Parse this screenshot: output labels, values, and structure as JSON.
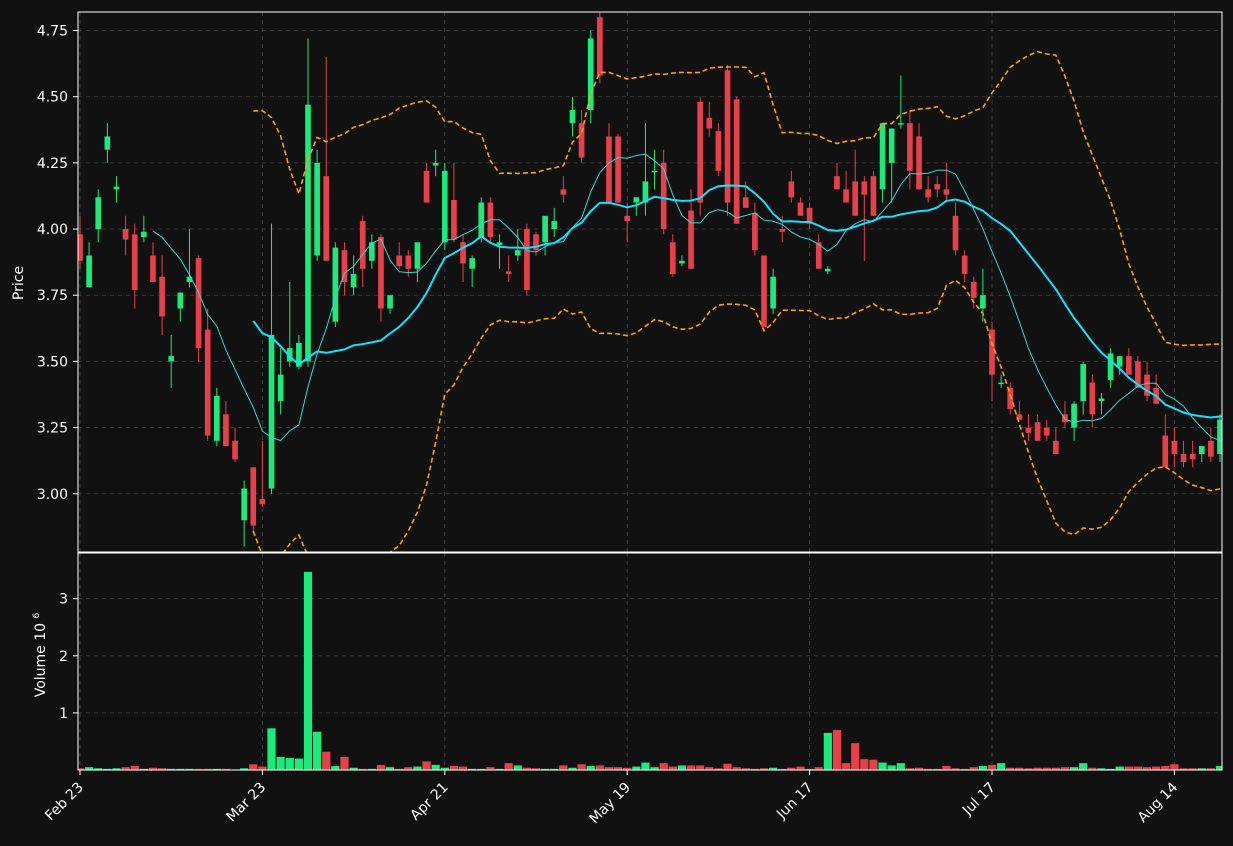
{
  "chart_data": {
    "type": "candlestick",
    "price_panel": {
      "ylabel": "Price",
      "yticks": [
        3.0,
        3.25,
        3.5,
        3.75,
        4.0,
        4.25,
        4.5,
        4.75
      ],
      "ytick_labels": [
        "3.00",
        "3.25",
        "3.50",
        "3.75",
        "4.00",
        "4.25",
        "4.50",
        "4.75"
      ],
      "ylim": [
        2.78,
        4.82
      ],
      "grid": true
    },
    "volume_panel": {
      "ylabel": "Volume",
      "ylabel_exponent": "10",
      "ylabel_exponent_power": "6",
      "yticks": [
        1,
        2,
        3
      ],
      "ytick_labels": [
        "1",
        "2",
        "3"
      ],
      "ylim": [
        0,
        3.8
      ],
      "unit": "millions",
      "grid": true
    },
    "x_tick_labels": [
      "Feb 23",
      "Mar 23",
      "Apr 21",
      "May 19",
      "Jun 17",
      "Jul 17",
      "Aug 14"
    ],
    "x_tick_index": [
      0,
      20,
      40,
      60,
      80,
      100,
      120
    ],
    "candles": [
      [
        3.98,
        4.05,
        3.85,
        3.88,
        0.03
      ],
      [
        3.78,
        3.95,
        3.78,
        3.9,
        0.05
      ],
      [
        4.0,
        4.15,
        3.95,
        4.12,
        0.03
      ],
      [
        4.3,
        4.4,
        4.25,
        4.35,
        0.02
      ],
      [
        4.15,
        4.2,
        4.1,
        4.16,
        0.03
      ],
      [
        4.0,
        4.05,
        3.9,
        3.96,
        0.05
      ],
      [
        3.98,
        4.02,
        3.7,
        3.77,
        0.07
      ],
      [
        3.97,
        4.05,
        3.95,
        3.99,
        0.02
      ],
      [
        3.9,
        3.95,
        3.8,
        3.8,
        0.04
      ],
      [
        3.82,
        3.9,
        3.6,
        3.67,
        0.03
      ],
      [
        3.5,
        3.6,
        3.4,
        3.52,
        0.02
      ],
      [
        3.7,
        3.75,
        3.65,
        3.76,
        0.02
      ],
      [
        3.8,
        4.0,
        3.78,
        3.82,
        0.02
      ],
      [
        3.89,
        3.9,
        3.5,
        3.55,
        0.02
      ],
      [
        3.62,
        3.7,
        3.2,
        3.22,
        0.02
      ],
      [
        3.2,
        3.4,
        3.18,
        3.37,
        0.02
      ],
      [
        3.3,
        3.35,
        3.18,
        3.18,
        0.02
      ],
      [
        3.2,
        3.25,
        3.12,
        3.13,
        0.01
      ],
      [
        2.9,
        3.05,
        2.8,
        3.02,
        0.03
      ],
      [
        3.1,
        3.1,
        2.85,
        2.88,
        0.1
      ],
      [
        2.98,
        3.2,
        2.95,
        2.96,
        0.06
      ],
      [
        3.02,
        4.02,
        3.0,
        3.6,
        0.73
      ],
      [
        3.35,
        3.55,
        3.3,
        3.45,
        0.23
      ],
      [
        3.5,
        3.8,
        3.48,
        3.55,
        0.21
      ],
      [
        3.48,
        3.6,
        3.47,
        3.57,
        0.2
      ],
      [
        3.5,
        4.72,
        3.48,
        4.47,
        3.47
      ],
      [
        3.9,
        4.3,
        3.88,
        4.25,
        0.67
      ],
      [
        4.2,
        4.65,
        3.88,
        3.88,
        0.32
      ],
      [
        3.65,
        3.95,
        3.63,
        3.93,
        0.07
      ],
      [
        3.92,
        3.95,
        3.75,
        3.8,
        0.23
      ],
      [
        3.78,
        3.9,
        3.75,
        3.83,
        0.04
      ],
      [
        4.03,
        4.05,
        3.78,
        3.85,
        0.02
      ],
      [
        3.88,
        3.98,
        3.85,
        3.95,
        0.02
      ],
      [
        3.97,
        3.98,
        3.65,
        3.7,
        0.09
      ],
      [
        3.7,
        3.75,
        3.68,
        3.75,
        0.05
      ],
      [
        3.9,
        3.95,
        3.85,
        3.86,
        0.02
      ],
      [
        3.9,
        3.92,
        3.82,
        3.85,
        0.05
      ],
      [
        3.85,
        3.9,
        3.8,
        3.95,
        0.06
      ],
      [
        4.22,
        4.25,
        4.1,
        4.1,
        0.15
      ],
      [
        4.24,
        4.3,
        4.2,
        4.25,
        0.09
      ],
      [
        3.95,
        4.25,
        3.92,
        4.22,
        0.04
      ],
      [
        4.11,
        4.25,
        3.95,
        3.96,
        0.07
      ],
      [
        3.95,
        3.98,
        3.8,
        3.87,
        0.06
      ],
      [
        3.85,
        3.9,
        3.78,
        3.89,
        0.02
      ],
      [
        3.97,
        4.12,
        3.95,
        4.1,
        0.02
      ],
      [
        4.1,
        4.12,
        3.95,
        3.97,
        0.05
      ],
      [
        3.94,
        3.98,
        3.85,
        3.95,
        0.02
      ],
      [
        3.84,
        3.9,
        3.8,
        3.83,
        0.12
      ],
      [
        3.9,
        4.0,
        3.88,
        3.92,
        0.08
      ],
      [
        4.0,
        4.02,
        3.75,
        3.77,
        0.04
      ],
      [
        3.98,
        3.99,
        3.9,
        3.92,
        0.03
      ],
      [
        3.95,
        4.05,
        3.9,
        4.05,
        0.02
      ],
      [
        4.0,
        4.08,
        3.97,
        4.03,
        0.02
      ],
      [
        4.15,
        4.2,
        4.1,
        4.13,
        0.08
      ],
      [
        4.4,
        4.5,
        4.35,
        4.45,
        0.04
      ],
      [
        4.4,
        4.45,
        4.25,
        4.27,
        0.1
      ],
      [
        4.45,
        4.75,
        4.4,
        4.72,
        0.07
      ],
      [
        4.8,
        4.82,
        4.55,
        4.58,
        0.08
      ],
      [
        4.35,
        4.4,
        4.15,
        4.1,
        0.05
      ],
      [
        4.35,
        4.36,
        4.15,
        4.1,
        0.05
      ],
      [
        4.05,
        4.1,
        3.95,
        4.03,
        0.04
      ],
      [
        4.1,
        4.12,
        4.05,
        4.12,
        0.06
      ],
      [
        4.1,
        4.4,
        4.05,
        4.18,
        0.13
      ],
      [
        4.22,
        4.3,
        4.15,
        4.22,
        0.05
      ],
      [
        4.25,
        4.3,
        3.98,
        4.0,
        0.12
      ],
      [
        3.95,
        3.98,
        3.82,
        3.83,
        0.06
      ],
      [
        3.87,
        3.9,
        3.86,
        3.88,
        0.08
      ],
      [
        4.07,
        4.15,
        3.85,
        3.85,
        0.08
      ],
      [
        4.48,
        4.5,
        4.05,
        4.1,
        0.08
      ],
      [
        4.42,
        4.48,
        4.35,
        4.38,
        0.05
      ],
      [
        4.37,
        4.4,
        4.2,
        4.22,
        0.03
      ],
      [
        4.6,
        4.62,
        4.05,
        4.1,
        0.11
      ],
      [
        4.49,
        4.5,
        4.02,
        4.02,
        0.05
      ],
      [
        4.12,
        4.18,
        4.08,
        4.08,
        0.03
      ],
      [
        4.06,
        4.1,
        3.9,
        3.92,
        0.02
      ],
      [
        3.9,
        3.9,
        3.65,
        3.63,
        0.03
      ],
      [
        3.7,
        3.85,
        3.68,
        3.82,
        0.04
      ],
      [
        4.0,
        4.05,
        3.95,
        3.99,
        0.02
      ],
      [
        4.18,
        4.22,
        4.1,
        4.12,
        0.04
      ],
      [
        4.1,
        4.12,
        4.08,
        4.05,
        0.06
      ],
      [
        4.08,
        4.1,
        4.0,
        4.02,
        0.02
      ],
      [
        3.95,
        3.98,
        3.85,
        3.85,
        0.05
      ],
      [
        3.84,
        3.86,
        3.83,
        3.85,
        0.65
      ],
      [
        4.2,
        4.25,
        4.15,
        4.15,
        0.7
      ],
      [
        4.15,
        4.22,
        4.1,
        4.1,
        0.12
      ],
      [
        4.18,
        4.3,
        4.05,
        4.05,
        0.47
      ],
      [
        4.18,
        4.2,
        3.88,
        4.13,
        0.19
      ],
      [
        4.2,
        4.22,
        4.05,
        4.05,
        0.18
      ],
      [
        4.15,
        4.4,
        4.1,
        4.4,
        0.13
      ],
      [
        4.25,
        4.35,
        4.1,
        4.38,
        0.08
      ],
      [
        4.4,
        4.58,
        4.38,
        4.4,
        0.12
      ],
      [
        4.4,
        4.45,
        4.15,
        4.22,
        0.03
      ],
      [
        4.35,
        4.4,
        4.15,
        4.15,
        0.04
      ],
      [
        4.15,
        4.2,
        4.1,
        4.12,
        0.02
      ],
      [
        4.17,
        4.2,
        4.12,
        4.15,
        0.02
      ],
      [
        4.15,
        4.25,
        4.1,
        4.13,
        0.07
      ],
      [
        4.05,
        4.1,
        3.9,
        3.92,
        0.03
      ],
      [
        3.9,
        3.92,
        3.8,
        3.83,
        0.02
      ],
      [
        3.8,
        3.82,
        3.7,
        3.74,
        0.05
      ],
      [
        3.7,
        3.85,
        3.65,
        3.75,
        0.07
      ],
      [
        3.62,
        3.65,
        3.35,
        3.45,
        0.09
      ],
      [
        3.42,
        3.45,
        3.4,
        3.42,
        0.12
      ],
      [
        3.4,
        3.42,
        3.3,
        3.32,
        0.04
      ],
      [
        3.3,
        3.35,
        3.28,
        3.28,
        0.04
      ],
      [
        3.25,
        3.3,
        3.2,
        3.23,
        0.03
      ],
      [
        3.27,
        3.3,
        3.2,
        3.2,
        0.04
      ],
      [
        3.25,
        3.28,
        3.2,
        3.22,
        0.04
      ],
      [
        3.2,
        3.25,
        3.15,
        3.15,
        0.04
      ],
      [
        3.3,
        3.35,
        3.25,
        3.27,
        0.05
      ],
      [
        3.25,
        3.35,
        3.2,
        3.34,
        0.05
      ],
      [
        3.35,
        3.5,
        3.3,
        3.49,
        0.12
      ],
      [
        3.42,
        3.45,
        3.25,
        3.3,
        0.04
      ],
      [
        3.35,
        3.38,
        3.3,
        3.36,
        0.03
      ],
      [
        3.43,
        3.55,
        3.4,
        3.53,
        0.02
      ],
      [
        3.48,
        3.5,
        3.45,
        3.52,
        0.06
      ],
      [
        3.52,
        3.55,
        3.45,
        3.45,
        0.06
      ],
      [
        3.5,
        3.52,
        3.4,
        3.4,
        0.06
      ],
      [
        3.45,
        3.5,
        3.35,
        3.37,
        0.05
      ],
      [
        3.4,
        3.45,
        3.35,
        3.34,
        0.06
      ],
      [
        3.22,
        3.3,
        3.1,
        3.1,
        0.07
      ],
      [
        3.2,
        3.25,
        3.1,
        3.15,
        0.1
      ],
      [
        3.15,
        3.2,
        3.1,
        3.12,
        0.03
      ],
      [
        3.15,
        3.2,
        3.1,
        3.13,
        0.03
      ],
      [
        3.15,
        3.18,
        3.12,
        3.18,
        0.03
      ],
      [
        3.2,
        3.25,
        3.12,
        3.14,
        0.03
      ],
      [
        3.15,
        3.3,
        3.12,
        3.28,
        0.07
      ],
      [
        3.27,
        3.35,
        3.25,
        3.3,
        0.07
      ]
    ],
    "colors": {
      "background": "#111111",
      "up": "#1aeb7a",
      "down": "#e8404a",
      "ma_fast": "#3ad6d0",
      "ma_slow": "#10e3ff",
      "bands": "#ffa000",
      "grid": "#3a3a3a",
      "frame": "#ffffff",
      "text": "#ffffff"
    }
  }
}
